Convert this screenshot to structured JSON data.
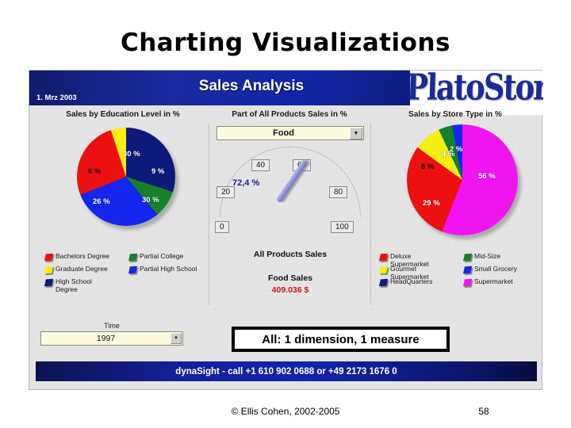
{
  "slide": {
    "title": "Charting Visualizations",
    "copyright": "© Ellis Cohen, 2002-2005",
    "page_number": "58",
    "annotation": "All: 1 dimension, 1 measure"
  },
  "app": {
    "title_bar": {
      "date": "1. Mrz 2003",
      "title": "Sales Analysis",
      "logo": "PlatoStores"
    },
    "status_bar": {
      "text": "dynaSight - call +1 610 902 0688 or +49 2173 1676 0"
    },
    "columns": {
      "left_heading": "Sales by Education Level in %",
      "center_heading": "Part of All Products Sales in %",
      "right_heading": "Sales by Store Type in %"
    },
    "product_select": {
      "value": "Food",
      "arrow": "chevron-down-icon"
    },
    "time_filter": {
      "label": "Time",
      "value": "1997",
      "arrow": "chevron-down-icon"
    },
    "center_panel": {
      "all_products_label": "All Products Sales",
      "food_sales_label": "Food Sales",
      "food_sales_value": "409.036 $"
    }
  },
  "chart_data": [
    {
      "type": "pie",
      "title": "Sales by Education Level in %",
      "categories": [
        "High School Degree",
        "Partial College",
        "Partial High School",
        "Bachelors Degree",
        "Graduate Degree"
      ],
      "values": [
        30,
        9,
        30,
        26,
        6
      ],
      "labels": [
        "30 %",
        "9 %",
        "30 %",
        "26 %",
        "6 %"
      ],
      "colors": [
        "#0d1a7a",
        "#15822a",
        "#1326ee",
        "#ec1010",
        "#f6ee12"
      ],
      "legend_position": "bottom",
      "legend": [
        {
          "label": "Bachelors Degree",
          "color": "#ec1010"
        },
        {
          "label": "Graduate Degree",
          "color": "#f6ee12"
        },
        {
          "label": "High School Degree",
          "color": "#0d1a7a"
        },
        {
          "label": "Partial College",
          "color": "#15822a"
        },
        {
          "label": "Partial High School",
          "color": "#1326ee"
        }
      ]
    },
    {
      "type": "gauge",
      "title": "Part of All Products Sales in %",
      "selected_product": "Food",
      "value": 72.4,
      "value_label": "72,4 %",
      "range": [
        0,
        100
      ],
      "ticks": [
        "0",
        "20",
        "40",
        "60",
        "80",
        "100"
      ],
      "tick_values": [
        0,
        20,
        40,
        60,
        80,
        100
      ]
    },
    {
      "type": "pie",
      "title": "Sales by Store Type in %",
      "categories": [
        "Supermarket",
        "Deluxe Supermarket",
        "Gourmet Supermarket",
        "Mid-Size",
        "Small Grocery"
      ],
      "values": [
        56,
        29,
        8,
        4,
        2
      ],
      "labels": [
        "56 %",
        "29 %",
        "8 %",
        "4 %",
        "2 %"
      ],
      "colors": [
        "#f015f0",
        "#ec1010",
        "#f6ee12",
        "#15822a",
        "#1326ee"
      ],
      "legend_position": "bottom",
      "legend": [
        {
          "label": "Deluxe Supermarket",
          "color": "#ec1010"
        },
        {
          "label": "Gourmet Supermarket",
          "color": "#f6ee12"
        },
        {
          "label": "HeadQuarters",
          "color": "#0d1a7a"
        },
        {
          "label": "Mid-Size",
          "color": "#15822a"
        },
        {
          "label": "Small Grocery",
          "color": "#1326ee"
        },
        {
          "label": "Supermarket",
          "color": "#f015f0"
        }
      ]
    }
  ]
}
